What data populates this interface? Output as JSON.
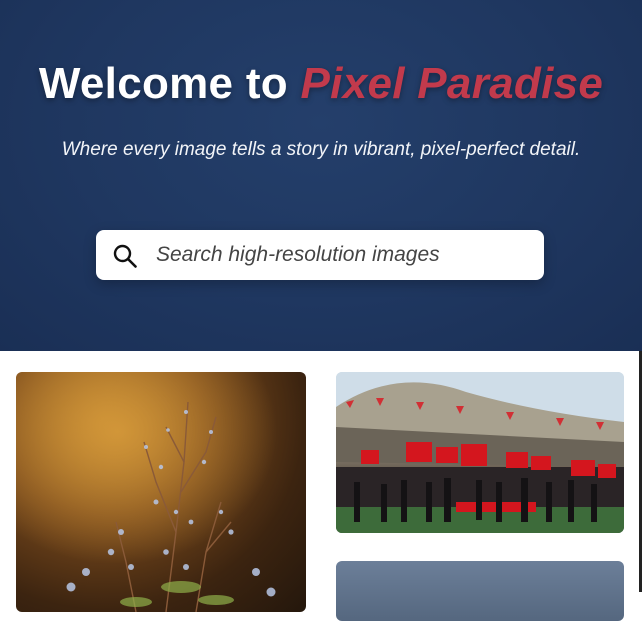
{
  "hero": {
    "title_prefix": "Welcome to ",
    "title_brand": "Pixel Paradise",
    "subtitle": "Where every image tells a story in vibrant, pixel-perfect detail."
  },
  "search": {
    "placeholder": "Search high-resolution images",
    "value": ""
  },
  "icons": {
    "search": "search-icon"
  },
  "colors": {
    "hero_background": "#1f3760",
    "brand_accent": "#c23a4c",
    "title_text": "#ffffff",
    "gallery_background": "#ffffff"
  }
}
